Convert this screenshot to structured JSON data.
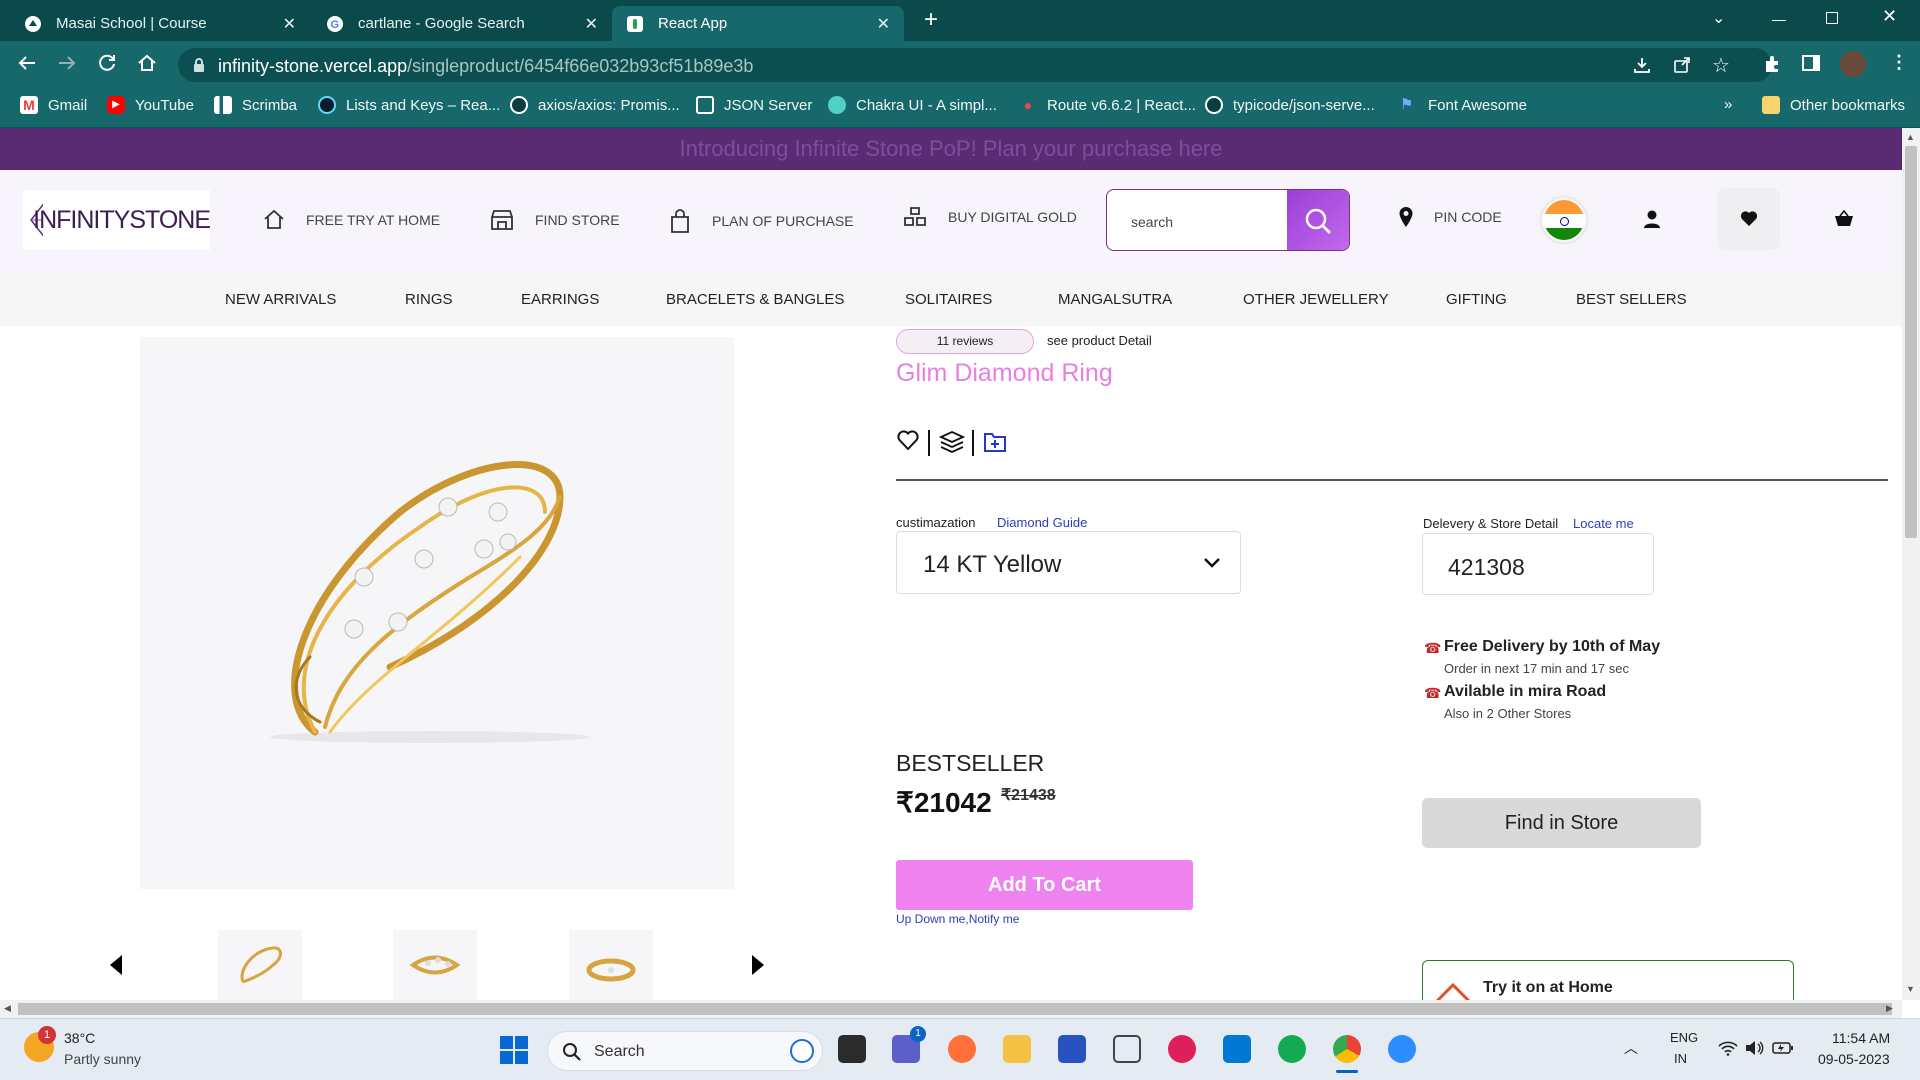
{
  "browser": {
    "tabs": [
      {
        "label": "Masai School | Course",
        "active": false
      },
      {
        "label": "cartlane - Google Search",
        "active": false
      },
      {
        "label": "React App",
        "active": true
      }
    ],
    "url_host": "infinity-stone.vercel.app",
    "url_path": "/singleproduct/6454f66e032b93cf51b89e3b",
    "bookmarks": [
      "Gmail",
      "YouTube",
      "Scrimba",
      "Lists and Keys – Rea...",
      "axios/axios: Promis...",
      "JSON Server",
      "Chakra UI - A simpl...",
      "Route v6.6.2 | React...",
      "typicode/json-serve...",
      "Font Awesome"
    ],
    "other_bookmarks": "Other bookmarks",
    "overflow": "»"
  },
  "site": {
    "promo": "Introducing Infinite Stone PoP! Plan your purchase here",
    "logo_text": "INFINITYSTONE",
    "header_nav": [
      "FREE TRY AT HOME",
      "FIND STORE",
      "PLAN OF PURCHASE",
      "BUY DIGITAL GOLD"
    ],
    "search_placeholder": "search",
    "pin_code_label": "PIN CODE",
    "menu": [
      "NEW ARRIVALS",
      "RINGS",
      "EARRINGS",
      "BRACELETS & BANGLES",
      "SOLITAIRES",
      "MANGALSUTRA",
      "OTHER JEWELLERY",
      "GIFTING",
      "BEST SELLERS"
    ]
  },
  "product": {
    "reviews": "11 reviews",
    "see_detail": "see product Detail",
    "title": "Glim Diamond Ring",
    "customization_label": "custimazation",
    "diamond_guide": "Diamond Guide",
    "customization_value": "14 KT Yellow",
    "delivery_label": "Delevery & Store Detail",
    "locate_me": "Locate me",
    "pincode": "421308",
    "free_delivery": "Free Delivery by 10th of May",
    "order_in": "Order in next 17 min and 17 sec",
    "available": "Avilable in mira Road",
    "other_stores": "Also in 2 Other Stores",
    "badge": "BESTSELLER",
    "price": "₹21042",
    "old_price": "₹21438",
    "add_to_cart": "Add To Cart",
    "notify": "Up Down me,Notify me",
    "find_in_store": "Find in Store",
    "try_home": "Try it on at Home"
  },
  "taskbar": {
    "temp": "38°C",
    "weather": "Partly sunny",
    "weather_badge": "1",
    "search": "Search",
    "lang1": "ENG",
    "lang2": "IN",
    "time": "11:54 AM",
    "date": "09-05-2023",
    "teams_badge": "1"
  },
  "colors": {
    "tabbar": "#0b4a4b",
    "toolbar": "#17686a",
    "promo": "#5a2a73",
    "accent_pink": "#ee82ee",
    "title_pink": "#e77fe2"
  }
}
